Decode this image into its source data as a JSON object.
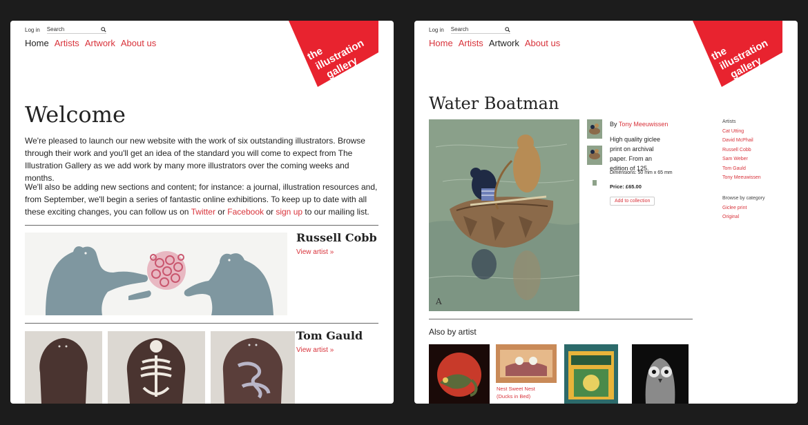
{
  "panel1": {
    "util": {
      "login": "Log in",
      "search_placeholder": "Search"
    },
    "nav": [
      "Home",
      "Artists",
      "Artwork",
      "About us"
    ],
    "nav_current": "Home",
    "logo_lines": [
      "the",
      "illustration",
      "gallery"
    ],
    "heading": "Welcome",
    "para1": "We're pleased to launch our new website with the work of six outstanding illustrators. Browse through their work and you'll get an idea of the standard you will come to expect from The Illustration Gallery as we add work by many more illustrators over the coming weeks and months.",
    "para2": {
      "text_a": "We'll also be adding new sections and content; for instance: a journal, illustration resources and, from September, we'll begin a series of fantastic online exhibitions. To keep up to date with all these exciting changes, you can follow us on ",
      "twitter": "Twitter",
      "or1": " or ",
      "facebook": "Facebook",
      "or2": " or ",
      "signup": "sign up",
      "text_b": " to our mailing list."
    },
    "artists": [
      {
        "name": "Russell Cobb",
        "link": "View artist »"
      },
      {
        "name": "Tom Gauld",
        "link": "View artist »"
      }
    ]
  },
  "panel2": {
    "util": {
      "login": "Log in",
      "search_placeholder": "Search"
    },
    "nav": [
      "Home",
      "Artists",
      "Artwork",
      "About us"
    ],
    "nav_current": "Artwork",
    "logo_lines": [
      "the",
      "illustration",
      "gallery"
    ],
    "title": "Water Boatman",
    "by_label": "By ",
    "artist": "Tony Meeuwissen",
    "description": "High quality giclee print on archival paper. From an edition of 125.",
    "dimensions": "Dimensions: 50 mm x 65 mm",
    "price": "Price: £65.00",
    "add_button": "Add to collection",
    "sidebar": {
      "artists_heading": "Artists",
      "artists": [
        "Cat Utting",
        "David McPhail",
        "Russell Cobb",
        "Sam Weber",
        "Tom Gauld",
        "Tony Meeuwissen"
      ],
      "category_heading": "Browse by category",
      "categories": [
        "Giclee print",
        "Original"
      ]
    },
    "also_heading": "Also by artist",
    "also_captions": [
      "Nest Sweet Nest",
      "(Ducks in Bed)"
    ]
  },
  "colors": {
    "accent": "#d8323a",
    "logo_red": "#e8232f",
    "background": "#1c1c1c"
  }
}
